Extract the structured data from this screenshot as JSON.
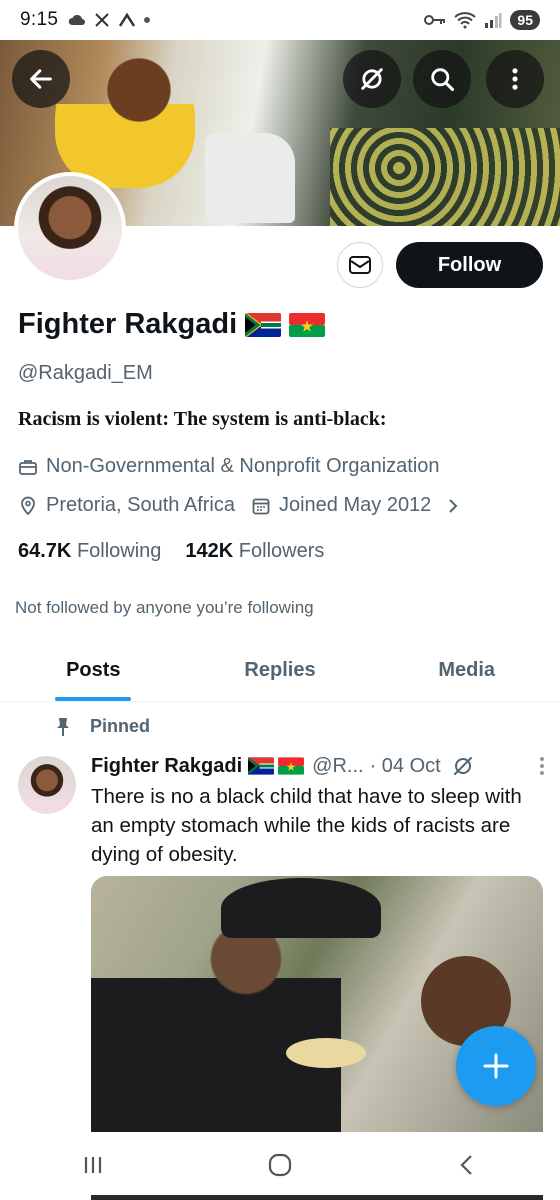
{
  "status_bar": {
    "time": "9:15",
    "battery": "95",
    "left_icons": [
      "cloud-icon",
      "x-logo-icon",
      "app-icon",
      "dot-icon"
    ],
    "right_icons": [
      "key-icon",
      "wifi-icon",
      "signal-icon"
    ]
  },
  "banner": {
    "buttons": [
      "back-icon",
      "grok-icon",
      "search-icon",
      "more-icon"
    ]
  },
  "profile": {
    "display_name": "Fighter Rakgadi",
    "flags": [
      "south-africa-flag",
      "burkina-faso-flag"
    ],
    "handle": "@Rakgadi_EM",
    "bio": "Racism is violent: The system is anti-black:",
    "category": "Non-Governmental & Nonprofit Organization",
    "location": "Pretoria, South Africa",
    "joined": "Joined May 2012",
    "following_count": "64.7K",
    "following_label": "Following",
    "followers_count": "142K",
    "followers_label": "Followers",
    "not_followed": "Not followed by anyone you’re following"
  },
  "actions": {
    "follow_label": "Follow"
  },
  "tabs": [
    {
      "label": "Posts",
      "active": true
    },
    {
      "label": "Replies",
      "active": false
    },
    {
      "label": "Media",
      "active": false
    }
  ],
  "tweet": {
    "pinned_label": "Pinned",
    "author_name": "Fighter Rakgadi",
    "author_handle_trunc": "@R...",
    "date": "· 04 Oct",
    "text": "There is no a black child that have to sleep with an empty stomach while the kids of racists are dying of obesity."
  },
  "colors": {
    "accent": "#1d9bf0",
    "text_primary": "#0f1419",
    "text_secondary": "#536471",
    "follow_button": "#0f1419"
  }
}
